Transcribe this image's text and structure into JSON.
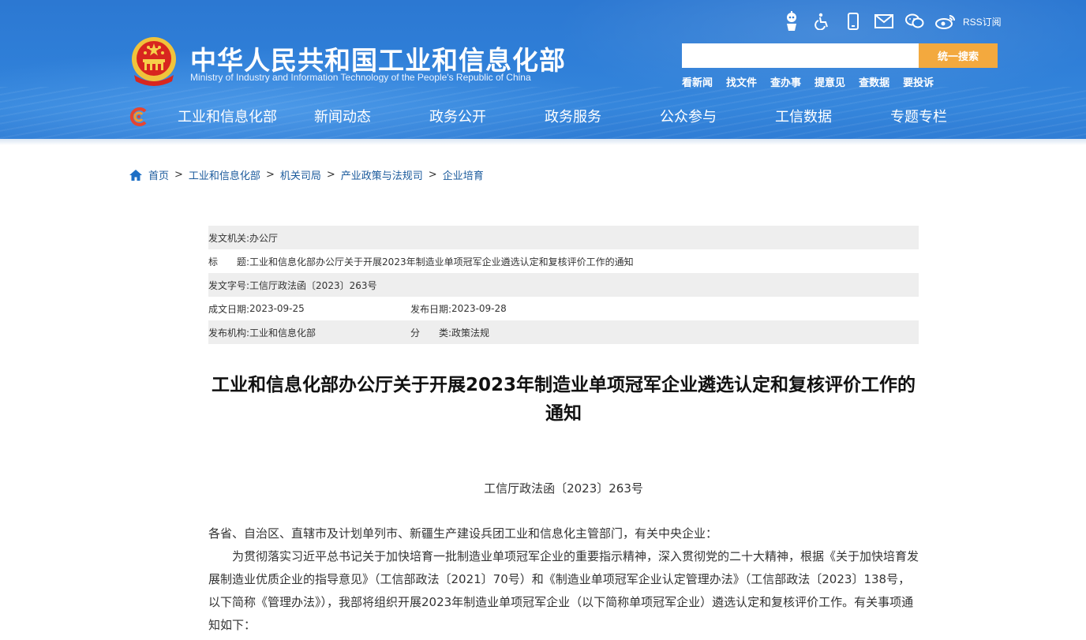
{
  "header": {
    "title": "中华人民共和国工业和信息化部",
    "subtitle": "Ministry of Industry and Information Technology of the People's Republic of China",
    "rss_label": "RSS订阅",
    "icons": [
      "accessibility-bot-icon",
      "wheelchair-icon",
      "mobile-icon",
      "mail-icon",
      "wechat-icon",
      "weibo-icon",
      "rss-icon"
    ],
    "colors": {
      "header_blue": "#2f7fd8",
      "search_button": "#f3a93e"
    }
  },
  "search": {
    "placeholder": "",
    "value": "",
    "button_label": "统一搜索"
  },
  "quick_links": [
    "看新闻",
    "找文件",
    "查办事",
    "提意见",
    "查数据",
    "要投诉"
  ],
  "nav": [
    "工业和信息化部",
    "新闻动态",
    "政务公开",
    "政务服务",
    "公众参与",
    "工信数据",
    "专题专栏"
  ],
  "breadcrumb": [
    "首页",
    "工业和信息化部",
    "机关司局",
    "产业政策与法规司",
    "企业培育"
  ],
  "breadcrumb_sep": ">",
  "meta": {
    "issuer_label": "发文机关:",
    "issuer": "办公厅",
    "title_label": "标　　题:",
    "title": "工业和信息化部办公厅关于开展2023年制造业单项冠军企业遴选认定和复核评价工作的通知",
    "docno_label": "发文字号:",
    "docno": "工信厅政法函〔2023〕263号",
    "created_label": "成文日期:",
    "created": "2023-09-25",
    "published_label": "发布日期:",
    "published": "2023-09-28",
    "org_label": "发布机构:",
    "org": "工业和信息化部",
    "category_label": "分　　类:",
    "category": "政策法规"
  },
  "article": {
    "title": "工业和信息化部办公厅关于开展2023年制造业单项冠军企业遴选认定和复核评价工作的通知",
    "doc_number": "工信厅政法函〔2023〕263号",
    "salutation": "各省、自治区、直辖市及计划单列市、新疆生产建设兵团工业和信息化主管部门，有关中央企业：",
    "paragraph1": "为贯彻落实习近平总书记关于加快培育一批制造业单项冠军企业的重要指示精神，深入贯彻党的二十大精神，根据《关于加快培育发展制造业优质企业的指导意见》（工信部政法〔2021〕70号）和《制造业单项冠军企业认定管理办法》（工信部政法〔2023〕138号，以下简称《管理办法》），我部将组织开展2023年制造业单项冠军企业（以下简称单项冠军企业）遴选认定和复核评价工作。有关事项通知如下："
  }
}
